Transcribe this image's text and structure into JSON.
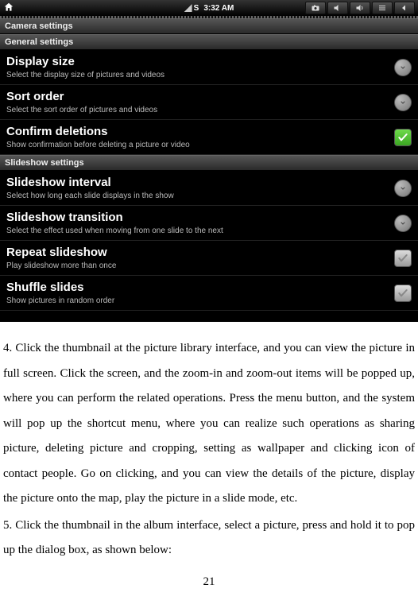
{
  "statusbar": {
    "time": "3:32 AM",
    "signal_label": "S",
    "icons": [
      "home",
      "camera",
      "vol-down",
      "vol-up",
      "menu",
      "back"
    ]
  },
  "screen_title": "Camera settings",
  "sections": [
    {
      "header": "General settings",
      "items": [
        {
          "title": "Display size",
          "sub": "Select the display size of pictures and videos",
          "control": "chevron"
        },
        {
          "title": "Sort order",
          "sub": "Select the sort order of pictures and videos",
          "control": "chevron"
        },
        {
          "title": "Confirm deletions",
          "sub": "Show confirmation before deleting a picture or video",
          "control": "checkbox",
          "checked": true
        }
      ]
    },
    {
      "header": "Slideshow settings",
      "items": [
        {
          "title": "Slideshow interval",
          "sub": "Select how long each slide displays in the show",
          "control": "chevron"
        },
        {
          "title": "Slideshow transition",
          "sub": "Select the effect used when moving from one slide to the next",
          "control": "chevron"
        },
        {
          "title": "Repeat slideshow",
          "sub": "Play slideshow more than once",
          "control": "checkbox",
          "checked": false
        },
        {
          "title": "Shuffle slides",
          "sub": "Show pictures in random order",
          "control": "checkbox",
          "checked": false
        }
      ]
    }
  ],
  "doc": {
    "p1": "4. Click the thumbnail at the picture library interface, and you can view the picture in full screen. Click the screen, and the zoom-in and zoom-out items will be popped up, where you can perform the related operations. Press the menu button, and the system will pop up the shortcut menu, where you can realize such operations as sharing picture, deleting picture and cropping, setting as wallpaper and clicking icon of contact people. Go on clicking, and you can view the details of the picture, display the picture onto the map, play the picture in a slide mode, etc.",
    "p2": "5. Click the thumbnail in the album interface, select a picture, press and hold it to pop up the dialog box, as shown below:",
    "page": "21"
  }
}
